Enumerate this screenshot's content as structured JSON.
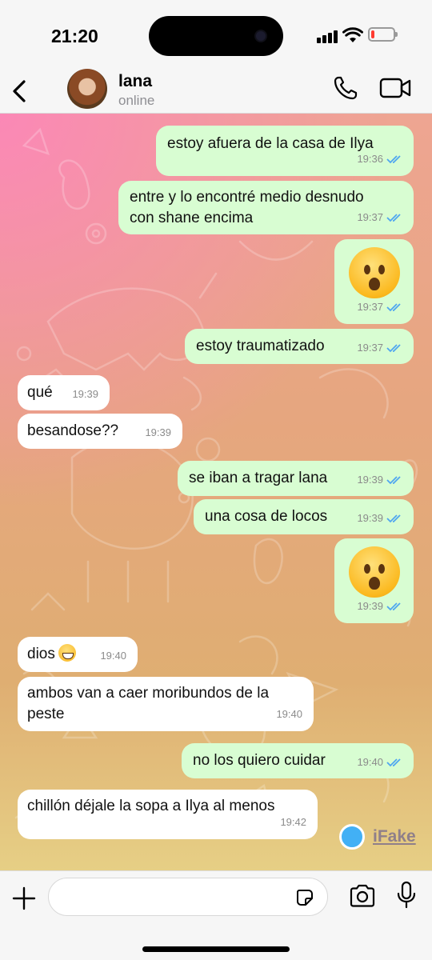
{
  "status_bar": {
    "time": "21:20",
    "battery_level": 0.15
  },
  "header": {
    "back_label": "back",
    "contact_name": "lana",
    "contact_status": "online"
  },
  "messages": [
    {
      "dir": "out",
      "text": "estoy afuera de la casa de Ilya",
      "time": "19:36",
      "read": true
    },
    {
      "dir": "out",
      "text": "entre y lo encontré medio desnudo con shane encima",
      "time": "19:37",
      "read": true
    },
    {
      "dir": "out",
      "emoji": "frowning-open-mouth-emoji",
      "time": "19:37",
      "read": true
    },
    {
      "dir": "out",
      "text": "estoy traumatizado",
      "time": "19:37",
      "read": true
    },
    {
      "dir": "in",
      "text": "qué",
      "time": "19:39"
    },
    {
      "dir": "in",
      "text": "besandose??",
      "time": "19:39"
    },
    {
      "dir": "out",
      "text": "se iban a tragar lana",
      "time": "19:39",
      "read": true
    },
    {
      "dir": "out",
      "text": "una cosa de locos",
      "time": "19:39",
      "read": true
    },
    {
      "dir": "out",
      "emoji": "frowning-open-mouth-emoji",
      "time": "19:39",
      "read": true
    },
    {
      "dir": "in",
      "text": "dios",
      "emoji": "grinning-face-emoji",
      "time": "19:40"
    },
    {
      "dir": "in",
      "text": "ambos van a caer moribundos de la peste",
      "time": "19:40"
    },
    {
      "dir": "out",
      "text": "no los quiero cuidar",
      "time": "19:40",
      "read": true
    },
    {
      "dir": "in",
      "text": "chillón déjale la sopa a Ilya al menos",
      "time": "19:42"
    }
  ],
  "watermark": {
    "label": "iFake"
  },
  "composer": {
    "placeholder": ""
  },
  "colors": {
    "outgoing_bubble": "#d8fdd2",
    "incoming_bubble": "#ffffff",
    "read_ticks": "#4fa6f0",
    "battery_low": "#ff3b30"
  }
}
